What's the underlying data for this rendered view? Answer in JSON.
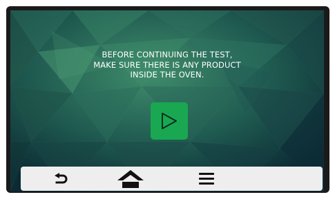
{
  "dialog": {
    "message_lines": [
      "BEFORE CONTINUING THE TEST,",
      "MAKE SURE THERE IS ANY PRODUCT",
      "INSIDE THE OVEN."
    ],
    "play_button_icon": "play-icon",
    "accent_color": "#19a851"
  },
  "bottom_bar": {
    "buttons": [
      {
        "name": "back",
        "icon": "back-arrow-icon"
      },
      {
        "name": "home",
        "icon": "home-icon"
      },
      {
        "name": "menu",
        "icon": "hamburger-menu-icon"
      }
    ]
  }
}
